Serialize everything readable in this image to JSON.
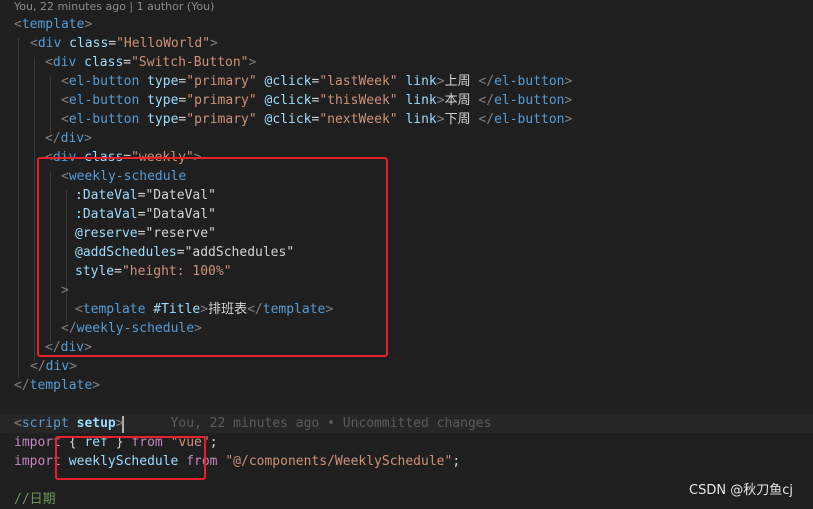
{
  "blame_header": "You, 22 minutes ago | 1 author (You)",
  "lines": [
    {
      "tokens": [
        {
          "t": "<",
          "c": "angle"
        },
        {
          "t": "template",
          "c": "tag"
        },
        {
          "t": ">",
          "c": "angle"
        }
      ]
    },
    {
      "tokens": [
        {
          "t": "<",
          "c": "angle"
        },
        {
          "t": "div",
          "c": "tag"
        },
        {
          "t": " "
        },
        {
          "t": "class",
          "c": "attr"
        },
        {
          "t": "=",
          "c": "text"
        },
        {
          "t": "\"HelloWorld\"",
          "c": "str"
        },
        {
          "t": ">",
          "c": "angle"
        }
      ]
    },
    {
      "tokens": [
        {
          "t": "<",
          "c": "angle"
        },
        {
          "t": "div",
          "c": "tag"
        },
        {
          "t": " "
        },
        {
          "t": "class",
          "c": "attr"
        },
        {
          "t": "=",
          "c": "text"
        },
        {
          "t": "\"Switch-Button\"",
          "c": "str"
        },
        {
          "t": ">",
          "c": "angle"
        }
      ]
    },
    {
      "tokens": [
        {
          "t": "<",
          "c": "angle"
        },
        {
          "t": "el-button",
          "c": "tag"
        },
        {
          "t": " "
        },
        {
          "t": "type",
          "c": "attr"
        },
        {
          "t": "=",
          "c": "text"
        },
        {
          "t": "\"primary\"",
          "c": "str"
        },
        {
          "t": " "
        },
        {
          "t": "@click",
          "c": "attr"
        },
        {
          "t": "=",
          "c": "text"
        },
        {
          "t": "\"lastWeek\"",
          "c": "str"
        },
        {
          "t": " "
        },
        {
          "t": "link",
          "c": "attr"
        },
        {
          "t": ">",
          "c": "angle"
        },
        {
          "t": "上周 ",
          "c": "text"
        },
        {
          "t": "</",
          "c": "angle"
        },
        {
          "t": "el-button",
          "c": "tag"
        },
        {
          "t": ">",
          "c": "angle"
        }
      ]
    },
    {
      "tokens": [
        {
          "t": "<",
          "c": "angle"
        },
        {
          "t": "el-button",
          "c": "tag"
        },
        {
          "t": " "
        },
        {
          "t": "type",
          "c": "attr"
        },
        {
          "t": "=",
          "c": "text"
        },
        {
          "t": "\"primary\"",
          "c": "str"
        },
        {
          "t": " "
        },
        {
          "t": "@click",
          "c": "attr"
        },
        {
          "t": "=",
          "c": "text"
        },
        {
          "t": "\"thisWeek\"",
          "c": "str"
        },
        {
          "t": " "
        },
        {
          "t": "link",
          "c": "attr"
        },
        {
          "t": ">",
          "c": "angle"
        },
        {
          "t": "本周 ",
          "c": "text"
        },
        {
          "t": "</",
          "c": "angle"
        },
        {
          "t": "el-button",
          "c": "tag"
        },
        {
          "t": ">",
          "c": "angle"
        }
      ]
    },
    {
      "tokens": [
        {
          "t": "<",
          "c": "angle"
        },
        {
          "t": "el-button",
          "c": "tag"
        },
        {
          "t": " "
        },
        {
          "t": "type",
          "c": "attr"
        },
        {
          "t": "=",
          "c": "text"
        },
        {
          "t": "\"primary\"",
          "c": "str"
        },
        {
          "t": " "
        },
        {
          "t": "@click",
          "c": "attr"
        },
        {
          "t": "=",
          "c": "text"
        },
        {
          "t": "\"nextWeek\"",
          "c": "str"
        },
        {
          "t": " "
        },
        {
          "t": "link",
          "c": "attr"
        },
        {
          "t": ">",
          "c": "angle"
        },
        {
          "t": "下周 ",
          "c": "text"
        },
        {
          "t": "</",
          "c": "angle"
        },
        {
          "t": "el-button",
          "c": "tag"
        },
        {
          "t": ">",
          "c": "angle"
        }
      ]
    },
    {
      "tokens": [
        {
          "t": "</",
          "c": "angle"
        },
        {
          "t": "div",
          "c": "tag"
        },
        {
          "t": ">",
          "c": "angle"
        }
      ]
    },
    {
      "tokens": [
        {
          "t": "<",
          "c": "angle"
        },
        {
          "t": "div",
          "c": "tag"
        },
        {
          "t": " "
        },
        {
          "t": "class",
          "c": "attr"
        },
        {
          "t": "=",
          "c": "text"
        },
        {
          "t": "\"weekly\"",
          "c": "str"
        },
        {
          "t": ">",
          "c": "angle"
        }
      ]
    },
    {
      "tokens": [
        {
          "t": "<",
          "c": "angle"
        },
        {
          "t": "weekly-schedule",
          "c": "tag"
        }
      ]
    },
    {
      "tokens": [
        {
          "t": ":DateVal",
          "c": "attr"
        },
        {
          "t": "=",
          "c": "text"
        },
        {
          "t": "\"DateVal\"",
          "c": "text"
        }
      ]
    },
    {
      "tokens": [
        {
          "t": ":DataVal",
          "c": "attr"
        },
        {
          "t": "=",
          "c": "text"
        },
        {
          "t": "\"DataVal\"",
          "c": "text"
        }
      ]
    },
    {
      "tokens": [
        {
          "t": "@reserve",
          "c": "attr"
        },
        {
          "t": "=",
          "c": "text"
        },
        {
          "t": "\"reserve\"",
          "c": "text"
        }
      ]
    },
    {
      "tokens": [
        {
          "t": "@addSchedules",
          "c": "attr"
        },
        {
          "t": "=",
          "c": "text"
        },
        {
          "t": "\"addSchedules\"",
          "c": "text"
        }
      ]
    },
    {
      "tokens": [
        {
          "t": "style",
          "c": "attr"
        },
        {
          "t": "=",
          "c": "text"
        },
        {
          "t": "\"height: 100%\"",
          "c": "str"
        }
      ]
    },
    {
      "tokens": [
        {
          "t": ">",
          "c": "angle"
        }
      ]
    },
    {
      "tokens": [
        {
          "t": "<",
          "c": "angle"
        },
        {
          "t": "template",
          "c": "tag"
        },
        {
          "t": " "
        },
        {
          "t": "#Title",
          "c": "attr"
        },
        {
          "t": ">",
          "c": "angle"
        },
        {
          "t": "排班表",
          "c": "text"
        },
        {
          "t": "</",
          "c": "angle"
        },
        {
          "t": "template",
          "c": "tag"
        },
        {
          "t": ">",
          "c": "angle"
        }
      ]
    },
    {
      "tokens": [
        {
          "t": "</",
          "c": "angle"
        },
        {
          "t": "weekly-schedule",
          "c": "tag"
        },
        {
          "t": ">",
          "c": "angle"
        }
      ]
    },
    {
      "tokens": [
        {
          "t": "</",
          "c": "angle"
        },
        {
          "t": "div",
          "c": "tag"
        },
        {
          "t": ">",
          "c": "angle"
        }
      ]
    },
    {
      "tokens": [
        {
          "t": "</",
          "c": "angle"
        },
        {
          "t": "div",
          "c": "tag"
        },
        {
          "t": ">",
          "c": "angle"
        }
      ]
    },
    {
      "tokens": [
        {
          "t": "</",
          "c": "angle"
        },
        {
          "t": "template",
          "c": "tag"
        },
        {
          "t": ">",
          "c": "angle"
        }
      ]
    },
    {
      "tokens": []
    },
    {
      "tokens": [
        {
          "t": "<",
          "c": "angle"
        },
        {
          "t": "script",
          "c": "tag"
        },
        {
          "t": " "
        },
        {
          "t": "setup",
          "c": "attr",
          "b": true
        },
        {
          "t": ">",
          "c": "angle"
        },
        {
          "t": "      You, 22 minutes ago • Uncommitted changes",
          "c": "inline-blame"
        }
      ]
    },
    {
      "tokens": [
        {
          "t": "import",
          "c": "kw"
        },
        {
          "t": " { ",
          "c": "text"
        },
        {
          "t": "ref",
          "c": "var"
        },
        {
          "t": " } ",
          "c": "text"
        },
        {
          "t": "from",
          "c": "kw"
        },
        {
          "t": " ",
          "c": "text"
        },
        {
          "t": "\"vue\"",
          "c": "str"
        },
        {
          "t": ";",
          "c": "text"
        }
      ]
    },
    {
      "tokens": [
        {
          "t": "import",
          "c": "kw"
        },
        {
          "t": " ",
          "c": "text"
        },
        {
          "t": "weeklySchedule",
          "c": "var"
        },
        {
          "t": " ",
          "c": "text"
        },
        {
          "t": "from",
          "c": "kw"
        },
        {
          "t": " ",
          "c": "text"
        },
        {
          "t": "\"@/components/WeeklySchedule\"",
          "c": "str"
        },
        {
          "t": ";",
          "c": "text"
        }
      ]
    },
    {
      "tokens": []
    },
    {
      "tokens": [
        {
          "t": "//日期",
          "c": "comment"
        }
      ]
    }
  ],
  "watermark": "CSDN @秋刀鱼cj"
}
